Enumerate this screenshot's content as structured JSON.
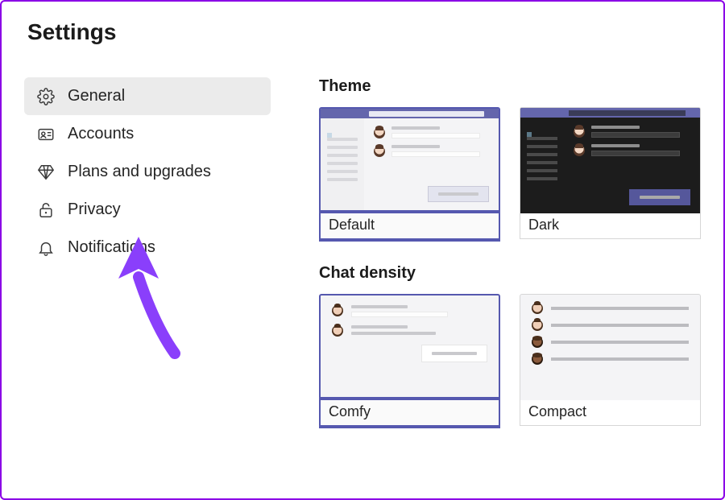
{
  "page": {
    "title": "Settings"
  },
  "sidebar": {
    "items": [
      {
        "label": "General",
        "icon": "gear-icon",
        "active": true
      },
      {
        "label": "Accounts",
        "icon": "id-card-icon",
        "active": false
      },
      {
        "label": "Plans and upgrades",
        "icon": "diamond-icon",
        "active": false
      },
      {
        "label": "Privacy",
        "icon": "lock-icon",
        "active": false
      },
      {
        "label": "Notifications",
        "icon": "bell-icon",
        "active": false
      }
    ]
  },
  "sections": {
    "theme": {
      "title": "Theme",
      "options": [
        {
          "label": "Default",
          "selected": true
        },
        {
          "label": "Dark",
          "selected": false
        }
      ]
    },
    "chat_density": {
      "title": "Chat density",
      "options": [
        {
          "label": "Comfy",
          "selected": true
        },
        {
          "label": "Compact",
          "selected": false
        }
      ]
    }
  },
  "annotation": {
    "arrow_target": "Notifications",
    "color": "#8a3ffb"
  }
}
